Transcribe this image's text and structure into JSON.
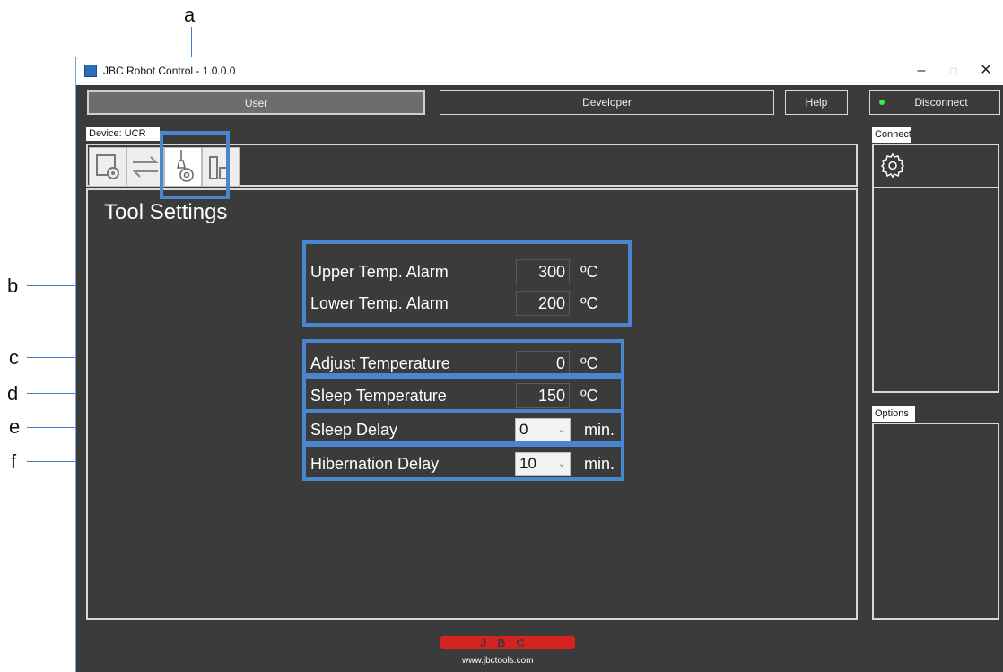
{
  "annotations": {
    "a": "a",
    "b": "b",
    "c": "c",
    "d": "d",
    "e": "e",
    "f": "f"
  },
  "window": {
    "title": "JBC Robot Control - 1.0.0.0",
    "minimize": "–",
    "maximize": "□",
    "close": "✕"
  },
  "toolbar": {
    "user": "User",
    "developer": "Developer",
    "help": "Help",
    "disconnect": "Disconnect",
    "led_color": "#3ee83e"
  },
  "device": {
    "tab": "Device: UCR"
  },
  "tabs": [
    {
      "icon": "station-settings-icon"
    },
    {
      "icon": "transfer-arrows-icon"
    },
    {
      "icon": "tool-settings-icon",
      "selected": true
    },
    {
      "icon": "bar-chart-icon"
    }
  ],
  "settings": {
    "heading": "Tool Settings",
    "upper_alarm": {
      "label": "Upper Temp. Alarm",
      "value": "300",
      "unit": "ºC"
    },
    "lower_alarm": {
      "label": "Lower Temp. Alarm",
      "value": "200",
      "unit": "ºC"
    },
    "adjust_temp": {
      "label": "Adjust Temperature",
      "value": "0",
      "unit": "ºC"
    },
    "sleep_temp": {
      "label": "Sleep Temperature",
      "value": "150",
      "unit": "ºC"
    },
    "sleep_delay": {
      "label": "Sleep Delay",
      "value": "0",
      "unit": "min."
    },
    "hibernation_delay": {
      "label": "Hibernation Delay",
      "value": "10",
      "unit": "min."
    }
  },
  "side": {
    "connect_tab": "Connect",
    "options_tab": "Options"
  },
  "footer": {
    "logo": "JBC",
    "website": "www.jbctools.com"
  },
  "colors": {
    "background": "#3b3b3b",
    "highlight": "#4a86d0",
    "logo_red": "#d5231f"
  }
}
